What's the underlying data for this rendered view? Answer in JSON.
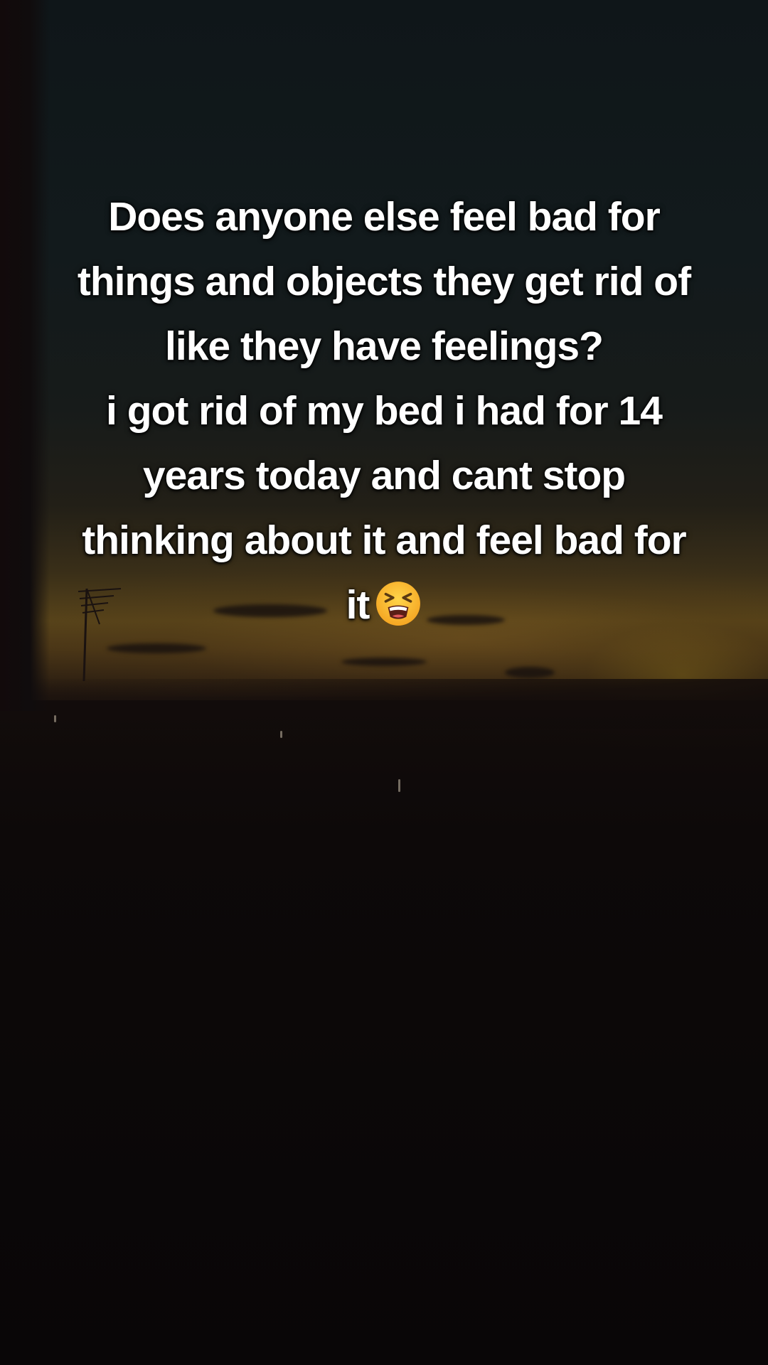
{
  "caption": {
    "lines": [
      "Does anyone else feel bad for",
      "things and objects they get rid of",
      "like they have feelings?",
      "i got rid of my bed i had for 14",
      "years today and cant stop",
      "thinking about it and feel bad for",
      "it"
    ],
    "emoji": "tired-face-emoji"
  },
  "scene": {
    "sky_color": "#121a1c",
    "sunset_color": "#57431a",
    "ground_color": "#0d0909",
    "text_color": "#ffffff"
  }
}
